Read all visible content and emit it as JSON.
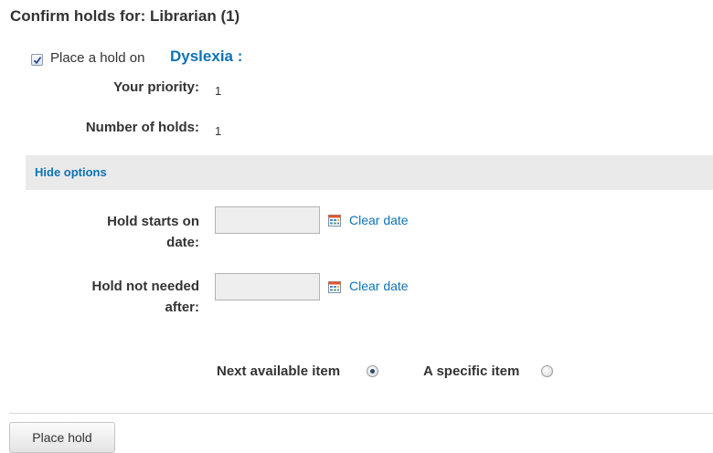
{
  "header": {
    "title": "Confirm holds for: Librarian (1)"
  },
  "hold": {
    "checked": true,
    "place_label": "Place a hold on",
    "book_title": "Dyslexia :",
    "priority_label": "Your priority:",
    "priority_value": "1",
    "num_holds_label": "Number of holds:",
    "num_holds_value": "1"
  },
  "options": {
    "toggle_label": "Hide options",
    "start_label_line1": "Hold starts on",
    "start_label_line2": "date:",
    "start_value": "",
    "expire_label_line1": "Hold not needed",
    "expire_label_line2": "after:",
    "expire_value": "",
    "clear_date_label": "Clear date",
    "next_available_label": "Next available item",
    "specific_item_label": "A specific item",
    "selected": "next_available"
  },
  "actions": {
    "place_hold_label": "Place hold"
  },
  "colors": {
    "link": "#0f73b5",
    "options_bar": "#eaeaea"
  },
  "icons": {
    "checkbox_mark": "checkmark-icon",
    "date_picker": "calendar-icon"
  }
}
